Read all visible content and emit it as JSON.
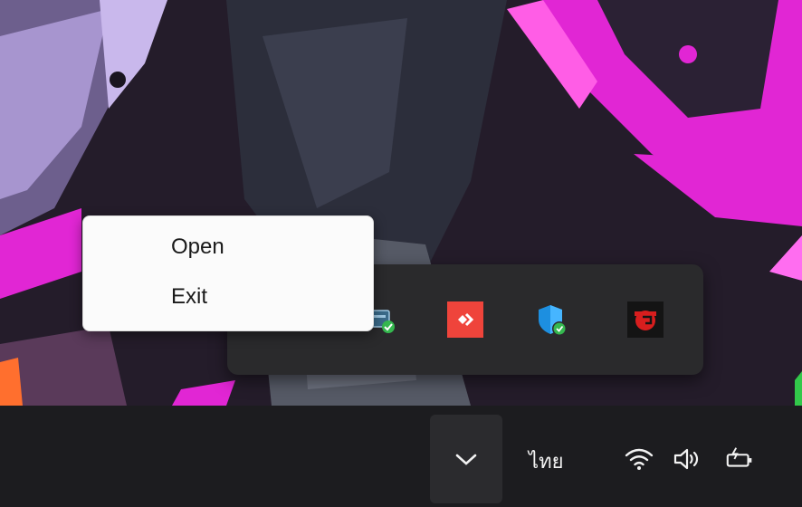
{
  "context_menu": {
    "items": [
      {
        "label": "Open"
      },
      {
        "label": "Exit"
      }
    ]
  },
  "tray_flyout": {
    "icons": [
      {
        "name": "network-adapter-app",
        "badge": "check"
      },
      {
        "name": "anydesk",
        "color": "#ef443b"
      },
      {
        "name": "windows-security",
        "badge": "check"
      },
      {
        "name": "garena",
        "color": "#d81e1e"
      }
    ]
  },
  "taskbar": {
    "show_hidden_icons": "chevron-up",
    "language": "ไทย",
    "status_icons": [
      "wifi-icon",
      "speaker-icon",
      "battery-icon"
    ]
  }
}
